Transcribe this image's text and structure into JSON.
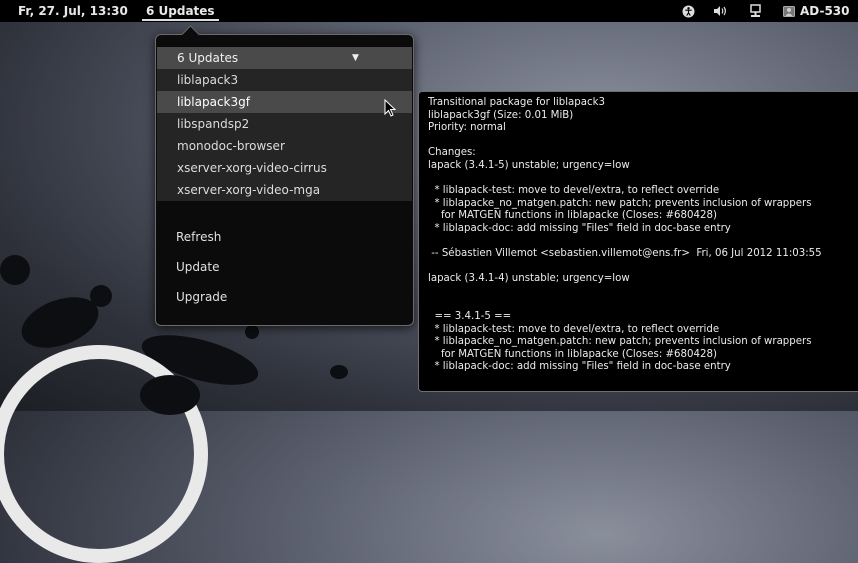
{
  "panel": {
    "clock": "Fr, 27. Jul, 13:30",
    "updates_indicator": "6 Updates",
    "user_label": "AD-530",
    "tray_icons": [
      "accessibility-icon",
      "volume-icon",
      "network-icon",
      "user-icon"
    ]
  },
  "menu": {
    "header": "6 Updates",
    "header_arrow": "▼",
    "packages": [
      "liblapack3",
      "liblapack3gf",
      "libspandsp2",
      "monodoc-browser",
      "xserver-xorg-video-cirrus",
      "xserver-xorg-video-mga"
    ],
    "hovered_index": 1,
    "actions": {
      "refresh": "Refresh",
      "update": "Update",
      "upgrade": "Upgrade"
    }
  },
  "tooltip": {
    "text": "Transitional package for liblapack3\nliblapack3gf (Size: 0.01 MiB)\nPriority: normal\n\nChanges:\nlapack (3.4.1-5) unstable; urgency=low\n\n  * liblapack-test: move to devel/extra, to reflect override\n  * liblapacke_no_matgen.patch: new patch; prevents inclusion of wrappers\n    for MATGEN functions in liblapacke (Closes: #680428)\n  * liblapack-doc: add missing \"Files\" field in doc-base entry\n\n -- Sébastien Villemot <sebastien.villemot@ens.fr>  Fri, 06 Jul 2012 11:03:55\n\nlapack (3.4.1-4) unstable; urgency=low\n\n\n  == 3.4.1-5 ==\n  * liblapack-test: move to devel/extra, to reflect override\n  * liblapacke_no_matgen.patch: new patch; prevents inclusion of wrappers\n    for MATGEN functions in liblapacke (Closes: #680428)\n  * liblapack-doc: add missing \"Files\" field in doc-base entry"
  },
  "colors": {
    "panel_bg": "#000000",
    "menu_bg": "#0b0b0b",
    "menu_header_bg": "#4a4a4a",
    "list_bg": "#252525",
    "hover_bg": "#4a4a4a"
  }
}
